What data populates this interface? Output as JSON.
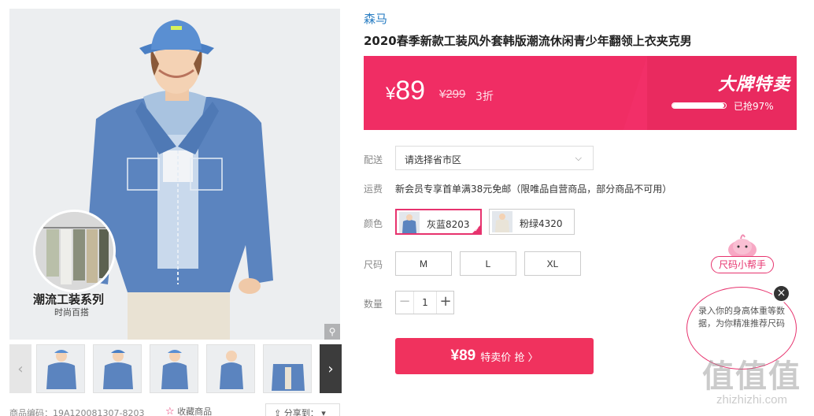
{
  "gallery": {
    "badge_title": "潮流工装系列",
    "badge_subtitle": "时尚百搭",
    "zoom_icon": "search-icon"
  },
  "thumbnails": {
    "count": 6,
    "prev_glyph": "‹",
    "next_glyph": "›"
  },
  "meta": {
    "product_code": "商品编码：19A120081307-8203",
    "favorite_label": "收藏商品",
    "share_label": "分享到："
  },
  "product": {
    "brand": "森马",
    "title": "2020春季新款工装风外套韩版潮流休闲青少年翻领上衣夹克男"
  },
  "price_banner": {
    "currency": "¥",
    "price": "89",
    "original_price": "¥299",
    "discount": "3折",
    "promo_title": "大牌特卖",
    "sold_progress": 0.97,
    "sold_text": "已抢97%",
    "bg_color": "#f02d64"
  },
  "delivery": {
    "label": "配送",
    "select_value": "请选择省市区"
  },
  "shipping": {
    "label": "运费",
    "text": "新会员专享首单满38元免邮（限唯品自营商品，部分商品不可用）"
  },
  "colors": {
    "label": "颜色",
    "options": [
      {
        "label": "灰蓝8203",
        "selected": true
      },
      {
        "label": "粉绿4320",
        "selected": false
      }
    ]
  },
  "sizes": {
    "label": "尺码",
    "options": [
      "M",
      "L",
      "XL"
    ]
  },
  "quantity": {
    "label": "数量",
    "value": "1",
    "minus": "−",
    "plus": "+"
  },
  "buy": {
    "price": "¥89",
    "label": "特卖价 抢 〉"
  },
  "size_helper": {
    "tag": "尺码小帮手",
    "bubble_text": "录入你的身高体重等数据，为你精准推荐尺码",
    "close": "×"
  },
  "watermark": {
    "big": "值值值",
    "url": "zhizhizhi.com"
  },
  "accent_color": "#e7336e"
}
